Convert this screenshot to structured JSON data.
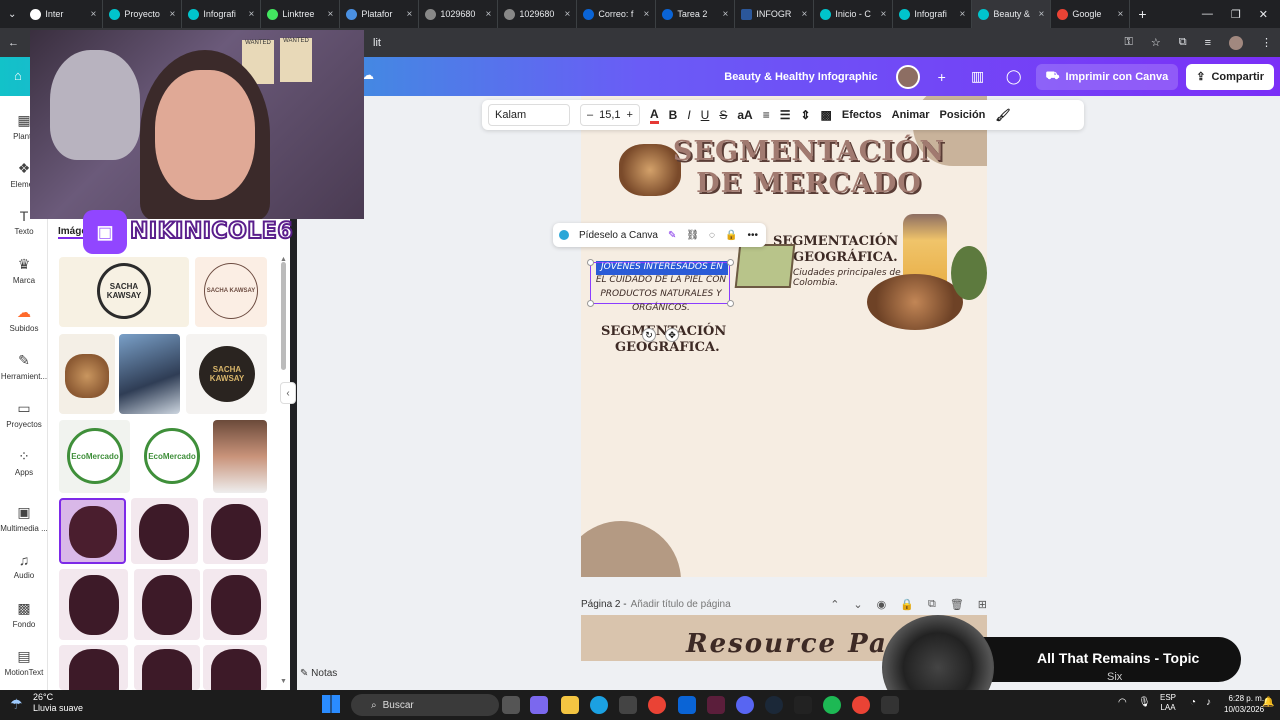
{
  "browser": {
    "tabs": [
      {
        "label": "Inter"
      },
      {
        "label": "Proyecto"
      },
      {
        "label": "Infografi"
      },
      {
        "label": "Linktree"
      },
      {
        "label": "Platafor"
      },
      {
        "label": "1029680"
      },
      {
        "label": "1029680"
      },
      {
        "label": "Correo: f"
      },
      {
        "label": "Tarea 2"
      },
      {
        "label": "INFOGR"
      },
      {
        "label": "Inicio - C"
      },
      {
        "label": "Infografi"
      },
      {
        "label": "Beauty &"
      },
      {
        "label": "Google"
      }
    ],
    "address_text": "lit"
  },
  "canva_header": {
    "design_title": "Beauty & Healthy Infographic",
    "print_label": "Imprimir con Canva",
    "share_label": "Compartir"
  },
  "rail": [
    {
      "label": "Plantil"
    },
    {
      "label": "Elemen"
    },
    {
      "label": "Texto"
    },
    {
      "label": "Marca"
    },
    {
      "label": "Subidos"
    },
    {
      "label": "Herramient..."
    },
    {
      "label": "Proyectos"
    },
    {
      "label": "Apps"
    },
    {
      "label": "Multimedia ..."
    },
    {
      "label": "Audio"
    },
    {
      "label": "Fondo"
    },
    {
      "label": "MotionText"
    }
  ],
  "panel": {
    "tab_label": "Imágen",
    "logo_sacha": "SACHA KAWSAY",
    "logo_ecomercado": "EcoMercado"
  },
  "stream": {
    "twitch_name": "NIKINICOLE6",
    "posters": [
      "WANTED",
      "WANTED"
    ]
  },
  "toolbar": {
    "font": "Kalam",
    "size": "15,1",
    "effects": "Efectos",
    "animate": "Animar",
    "position": "Posición"
  },
  "context_chip": {
    "ask": "Pídeselo a Canva"
  },
  "page": {
    "title_line1": "SEGMENTACIÓN",
    "title_line2": "DE MERCADO",
    "geo_title_line1": "SEGMENTACIÓN",
    "geo_title_line2": "GEOGRÁFICA.",
    "geo_text_line1": "Ciudades principales de",
    "geo_text_line2": "Colombia.",
    "sel_line1": "JOVENES INTERESADOS EN",
    "sel_line2": "EL CUIDADO DE LA PIEL CON",
    "sel_line3": "PRODUCTOS NATURALES Y",
    "sel_line4": "ORGÁNICOS.",
    "seg2_line1": "SEGMENTACIÓN",
    "seg2_line2": "GEOGRAFICA."
  },
  "page2": {
    "label": "Página 2 -",
    "placeholder": "Añadir título de página",
    "resource": "Resource Page"
  },
  "notes_label": "Notas",
  "music": {
    "title": "All That Remains - Topic",
    "subtitle": "Six"
  },
  "taskbar": {
    "temp": "26°C",
    "weather": "Lluvia suave",
    "search": "Buscar",
    "lang1": "ESP",
    "lang2": "LAA",
    "time": "6:28 p. m.",
    "date": "10/03/2026"
  }
}
